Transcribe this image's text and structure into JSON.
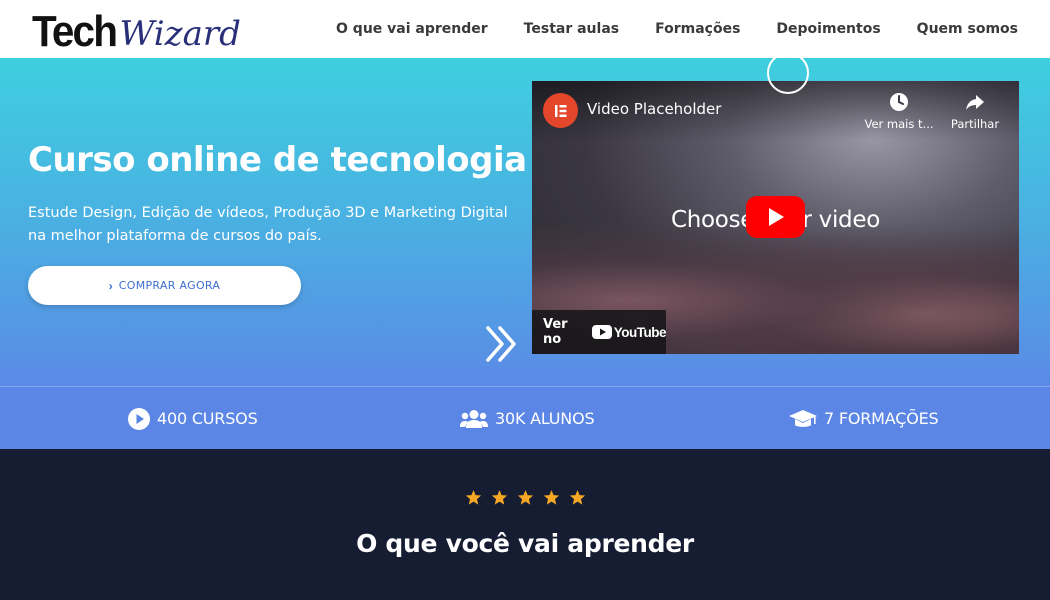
{
  "header": {
    "logo_part1": "Tech",
    "logo_part2": "Wizard",
    "nav": [
      "O que vai aprender",
      "Testar aulas",
      "Formações",
      "Depoimentos",
      "Quem somos"
    ]
  },
  "hero": {
    "title": "Curso online de tecnologia",
    "description": "Estude Design, Edição de vídeos, Produção 3D e Marketing Digital na melhor plataforma de cursos do país.",
    "cta_label": "COMPRAR AGORA",
    "cta_icon": "chevron-right-icon",
    "video": {
      "title": "Video Placeholder",
      "watch_later_label": "Ver mais t...",
      "share_label": "Partilhar",
      "overlay_text": "Choose your video",
      "watch_on_label": "Ver no",
      "youtube_label": "YouTube"
    }
  },
  "stats": [
    {
      "icon": "play-circle-icon",
      "label": "400 CURSOS"
    },
    {
      "icon": "users-icon",
      "label": "30K ALUNOS"
    },
    {
      "icon": "graduation-cap-icon",
      "label": "7 FORMAÇÕES"
    }
  ],
  "learn": {
    "rating_stars": 5,
    "title": "O que você vai aprender"
  },
  "colors": {
    "hero_top": "#3ecfdf",
    "hero_bottom": "#5b8ae6",
    "stats_bg": "#5b86e5",
    "dark_bg": "#161d33",
    "accent_blue": "#3b6fd2",
    "star": "#f5a623",
    "youtube_red": "#ff0000",
    "elementor_red": "#e4462b"
  }
}
